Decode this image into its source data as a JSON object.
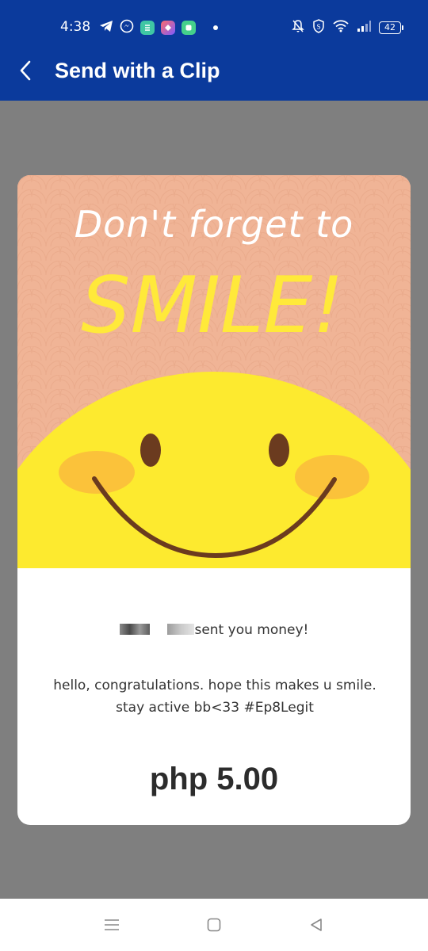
{
  "status_bar": {
    "time": "4:38",
    "battery": "42",
    "icons_left": [
      "telegram-icon",
      "messenger-icon",
      "app-icon-green",
      "app-icon-purple",
      "app-icon-teal"
    ],
    "icons_right": [
      "mute-icon",
      "shield-icon",
      "wifi-icon",
      "signal-icon",
      "battery-icon"
    ]
  },
  "header": {
    "back_icon": "chevron-left-icon",
    "title": "Send with a Clip"
  },
  "card": {
    "art": {
      "line1": "Don't forget to",
      "line2": "SMILE!",
      "colors": {
        "background": "#f0b496",
        "face": "#fdea2f",
        "cheeks": "#fbc23a",
        "features": "#6b3b1f",
        "text_top": "#ffffff",
        "text_big": "#ffe93a"
      }
    },
    "sender_suffix": "sent you money!",
    "message": "hello, congratulations. hope this makes u smile. stay active bb<33 #Ep8Legit",
    "amount": "php 5.00"
  },
  "nav_bar": {
    "icons": [
      "menu-icon",
      "home-icon",
      "back-icon"
    ]
  },
  "colors": {
    "brand": "#0b3a9c",
    "page_background": "#7f7f7f"
  }
}
